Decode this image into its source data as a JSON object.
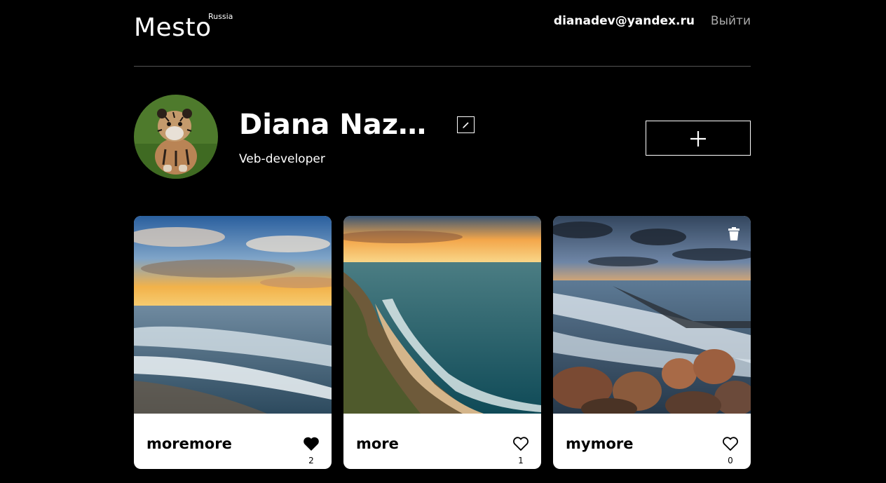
{
  "header": {
    "logo": "Mesto",
    "logo_sup": "Russia",
    "email": "dianadev@yandex.ru",
    "logout": "Выйти"
  },
  "profile": {
    "name": "Diana Nazar...",
    "about": "Veb-developer",
    "add_icon": "plus-icon",
    "edit_icon": "pencil-icon"
  },
  "cards": [
    {
      "title": "moremore",
      "likes": "2",
      "liked": true
    },
    {
      "title": "more",
      "likes": "1",
      "liked": false
    },
    {
      "title": "mymore",
      "likes": "0",
      "liked": false,
      "deletable": true
    }
  ],
  "colors": {
    "background": "#000000",
    "card": "#ffffff",
    "divider": "#545454",
    "muted": "#a9a9a9"
  }
}
